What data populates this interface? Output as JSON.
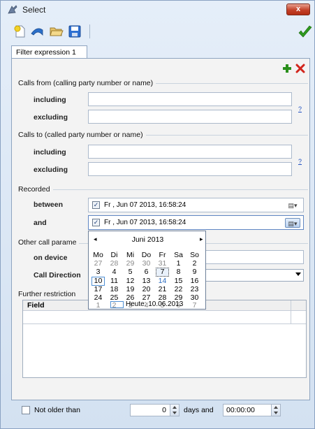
{
  "window": {
    "title": "Select",
    "close_label": "x"
  },
  "tab": {
    "label": "Filter expression 1"
  },
  "calls_from": {
    "title": "Calls from (calling party number or name)",
    "including_label": "including",
    "excluding_label": "excluding",
    "including_value": "",
    "excluding_value": "",
    "help": "?"
  },
  "calls_to": {
    "title": "Calls to (called party number or name)",
    "including_label": "including",
    "excluding_label": "excluding",
    "including_value": "",
    "excluding_value": "",
    "help": "?"
  },
  "recorded": {
    "title": "Recorded",
    "between_label": "between",
    "and_label": "and",
    "between_value": "Fr , Jun 07 2013, 16:58:24",
    "and_value": "Fr , Jun 07 2013, 16:58:24",
    "check_mark": "✓"
  },
  "other": {
    "title": "Other call parame",
    "on_device_label": "on device",
    "call_direction_label": "Call Direction"
  },
  "further": {
    "title": "Further restriction",
    "col_field": "Field"
  },
  "calendar": {
    "month": "Juni 2013",
    "prev": "◂",
    "next": "▸",
    "weekdays": [
      "Mo",
      "Di",
      "Mi",
      "Do",
      "Fr",
      "Sa",
      "So"
    ],
    "weeks": [
      [
        "27",
        "28",
        "29",
        "30",
        "31",
        "1",
        "2"
      ],
      [
        "3",
        "4",
        "5",
        "6",
        "7",
        "8",
        "9"
      ],
      [
        "10",
        "11",
        "12",
        "13",
        "14",
        "15",
        "16"
      ],
      [
        "17",
        "18",
        "19",
        "20",
        "21",
        "22",
        "23"
      ],
      [
        "24",
        "25",
        "26",
        "27",
        "28",
        "29",
        "30"
      ],
      [
        "1",
        "2",
        "3",
        "4",
        "5",
        "6",
        "7"
      ]
    ],
    "today_label": "Heute: 10.06.2013"
  },
  "bottom": {
    "not_older_label": "Not older than",
    "days_value": "0",
    "days_label": "days and",
    "time_value": "00:00:00"
  },
  "colors": {
    "accent": "#4f8fd3",
    "ok_green": "#2e9a1e",
    "delete_red": "#d2241b",
    "add_green": "#2a8f1b"
  }
}
